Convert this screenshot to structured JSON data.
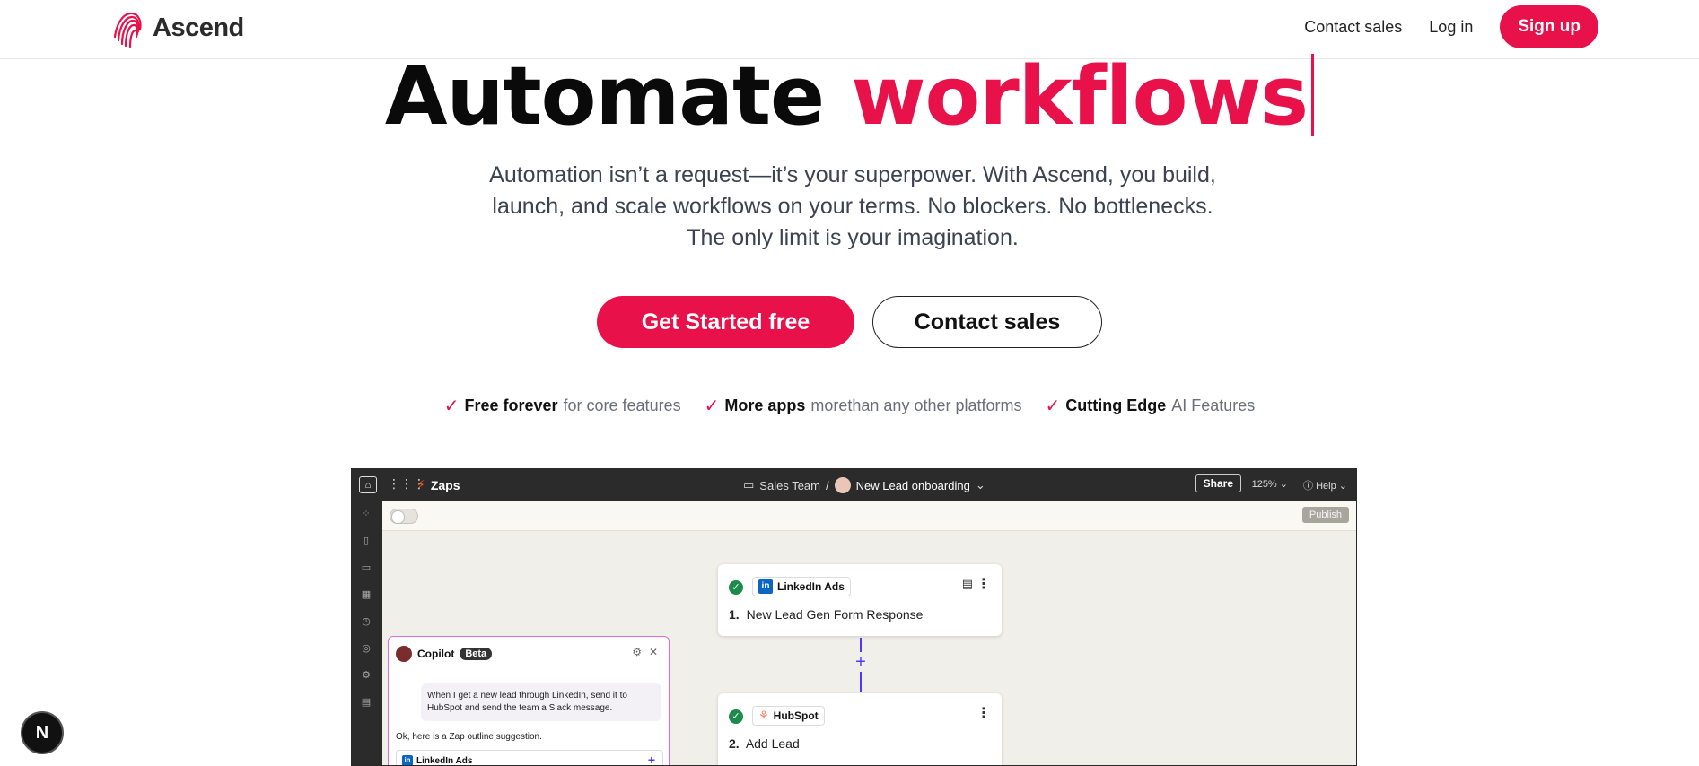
{
  "brand": {
    "name": "Ascend",
    "accent": "#e8114a"
  },
  "nav": {
    "contact_sales": "Contact sales",
    "login": "Log in",
    "signup": "Sign up"
  },
  "hero": {
    "title_word1": "Automate",
    "title_word2": "workflows",
    "subtitle": "Automation isn’t a request—it’s your superpower. With Ascend, you build, launch, and scale workflows on your terms. No blockers. No bottlenecks. The only limit is your imagination.",
    "cta_primary": "Get Started free",
    "cta_secondary": "Contact sales"
  },
  "features": [
    {
      "bold": "Free forever",
      "rest": "for core features"
    },
    {
      "bold": "More apps",
      "rest": "morethan any other platforms"
    },
    {
      "bold": "Cutting Edge",
      "rest": "AI Features"
    }
  ],
  "app": {
    "zaps_label": "Zaps",
    "breadcrumb_folder": "Sales Team",
    "breadcrumb_sep": "/",
    "breadcrumb_current": "New Lead onboarding",
    "share": "Share",
    "zoom": "125%",
    "help": "Help",
    "publish": "Publish",
    "steps": [
      {
        "app": "LinkedIn Ads",
        "number": "1.",
        "title": "New Lead Gen Form Response"
      },
      {
        "app": "HubSpot",
        "number": "2.",
        "title": "Add Lead"
      }
    ],
    "copilot": {
      "title": "Copilot",
      "badge": "Beta",
      "user_message": "When I get a new lead through LinkedIn, send it to HubSpot and send the team a Slack message.",
      "reply": "Ok, here is a Zap outline suggestion.",
      "suggestion_app": "LinkedIn Ads"
    }
  },
  "floating_badge": "N"
}
